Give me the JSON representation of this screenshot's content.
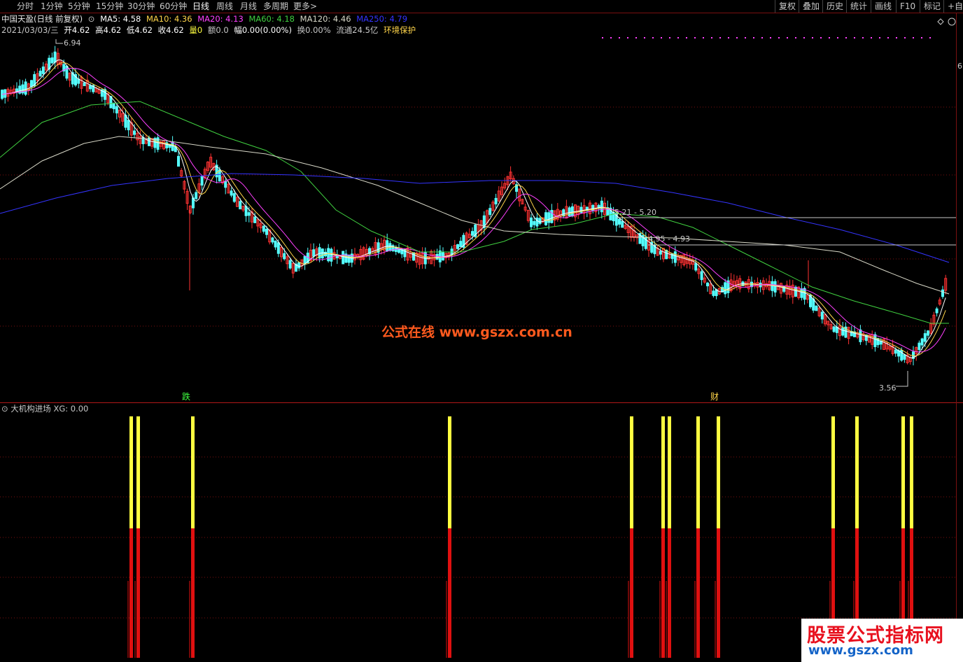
{
  "toolbar": {
    "timeframes": [
      "分时",
      "1分钟",
      "5分钟",
      "15分钟",
      "30分钟",
      "60分钟",
      "日线",
      "周线",
      "月线",
      "多周期",
      "更多>"
    ],
    "active_timeframe": "日线",
    "tools": [
      "复权",
      "叠加",
      "历史",
      "统计",
      "画线",
      "F10",
      "标记",
      "+自选"
    ]
  },
  "stock_header": {
    "name": "中国天盈(日线 前复权)",
    "ma5": "MA5: 4.58",
    "ma10": "MA10: 4.36",
    "ma20": "MA20: 4.13",
    "ma60": "MA60: 4.18",
    "ma120": "MA120: 4.46",
    "ma250": "MA250: 4.79"
  },
  "quote": {
    "date": "2021/03/03/三",
    "open": "开4.62",
    "high": "高4.62",
    "low": "低4.62",
    "close": "收4.62",
    "volume": "量0",
    "amount": "额0.0",
    "change": "幅0.00(0.00%)",
    "turnover": "换0.00%",
    "float": "流通24.5亿",
    "tag": "环境保护"
  },
  "annotations": {
    "high_price": "6.94",
    "low_price": "3.56",
    "zone1": "5.21 - 5.20",
    "zone2": "4.95 - 4.93",
    "right_axis_label": "6",
    "marker_fall": "跌",
    "marker_wealth": "财"
  },
  "sub_chart": {
    "title": "大机构进场",
    "value": "XG: 0.00"
  },
  "watermark": {
    "text": "公式在线  www.gszx.com.cn"
  },
  "logo": {
    "main": "股票公式指标网",
    "sub": "www.gszx.com"
  },
  "colors": {
    "up": "#ff3232",
    "down": "#54ffff",
    "ma5": "#ffffff",
    "ma10": "#ffd54a",
    "ma20": "#ff40ff",
    "ma60": "#40d040",
    "ma120": "#d8d8c8",
    "ma250": "#3434ff",
    "signal_top": "#ffff40",
    "signal_bottom": "#e01010",
    "grid": "#7a1010"
  },
  "chart_data": {
    "type": "candlestick_with_signals",
    "y_range": [
      3.56,
      6.94
    ],
    "signal_bars": 15
  }
}
